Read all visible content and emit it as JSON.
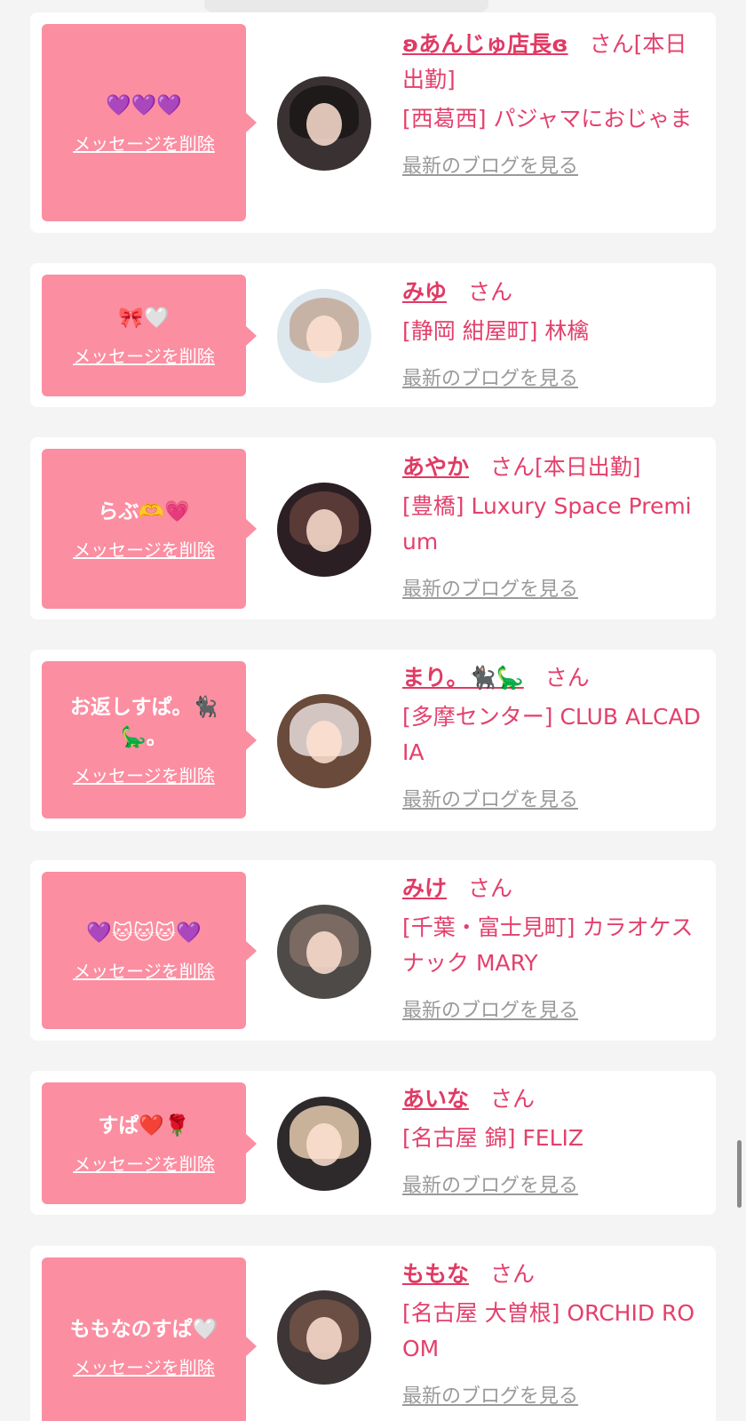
{
  "delete_label": "メッセージを削除",
  "blog_label": "最新のブログを見る",
  "honorific": "さん",
  "colors": {
    "bubble": "#fb8ea1",
    "accent": "#e3406c",
    "link_gray": "#9a9a9a",
    "background": "#f4f4f4"
  },
  "entries": [
    {
      "message": "💜💜💜",
      "name": "ʚあんじゅ店長ɞ",
      "status": "[本日出勤]",
      "shop": "[西葛西] パジャマにおじゃま",
      "avatar": "woman-portrait-dark-hair"
    },
    {
      "message": "🎀🤍",
      "name": "みゆ",
      "status": "",
      "shop": "[静岡 紺屋町] 林檎",
      "avatar": "woman-portrait-light"
    },
    {
      "message": "らぶ🫶💗",
      "name": "あやか",
      "status": "[本日出勤]",
      "shop": "[豊橋] Luxury Space Premium",
      "avatar": "woman-portrait-bunny-ears"
    },
    {
      "message": "お返しすぱ。🐈‍⬛🦕。",
      "name": "まり。🐈‍⬛🦕",
      "status": "",
      "shop": "[多摩センター] CLUB ALCADIA",
      "avatar": "woman-portrait-silver-hair"
    },
    {
      "message": "💜🐱🐱🐱💜",
      "name": "みけ",
      "status": "",
      "shop": "[千葉・富士見町] カラオケスナック MARY",
      "avatar": "woman-portrait-closeup"
    },
    {
      "message": "すぱ❤️🌹",
      "name": "あいな",
      "status": "",
      "shop": "[名古屋 錦] FELIZ",
      "avatar": "woman-portrait-heart-sticker"
    },
    {
      "message": "ももなのすぱ🤍",
      "name": "ももな",
      "status": "",
      "shop": "[名古屋 大曽根] ORCHID ROOM",
      "avatar": "woman-portrait-bottle"
    }
  ]
}
